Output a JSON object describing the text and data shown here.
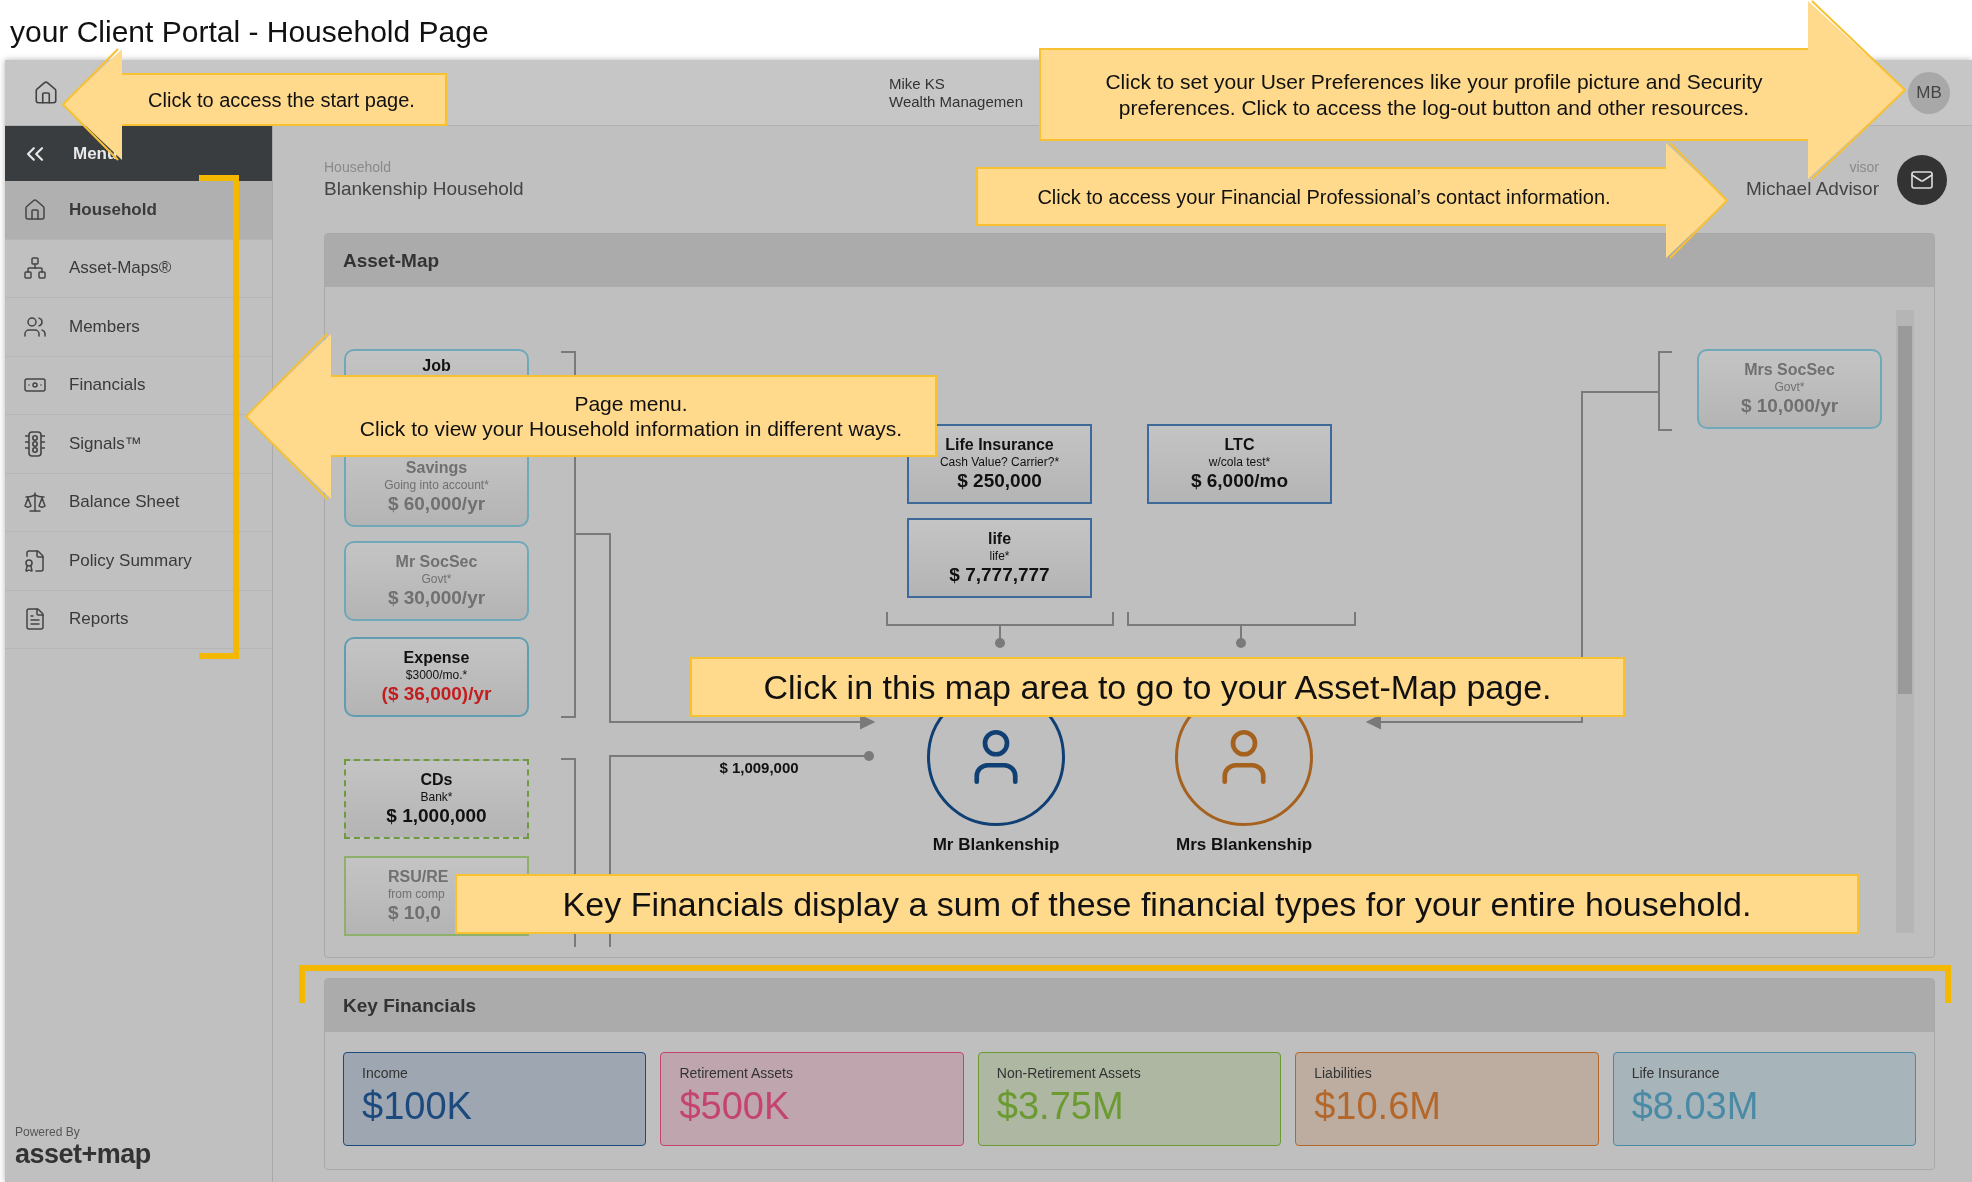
{
  "page_title": "your Client Portal - Household Page",
  "top_bar": {
    "firm_line_1": "Mike KS",
    "firm_line_2": "Wealth Managemen",
    "avatar": "MB"
  },
  "sidebar": {
    "menu_label": "Menu",
    "items": [
      {
        "label": "Household",
        "selected": true
      },
      {
        "label": "Asset-Maps®",
        "selected": false
      },
      {
        "label": "Members",
        "selected": false
      },
      {
        "label": "Financials",
        "selected": false
      },
      {
        "label": "Signals™",
        "selected": false
      },
      {
        "label": "Balance Sheet",
        "selected": false
      },
      {
        "label": "Policy Summary",
        "selected": false
      },
      {
        "label": "Reports",
        "selected": false
      }
    ],
    "powered_by": "Powered By",
    "logo": "asset+map"
  },
  "header": {
    "label": "Household",
    "name": "Blankenship Household",
    "advisor_label": "visor",
    "advisor_name": "Michael Advisor"
  },
  "asset_map": {
    "title": "Asset-Map",
    "nodes": [
      {
        "title": "Job",
        "kind": "income",
        "dimmed": false
      },
      {
        "title": "Savings",
        "subtitle": "Going into account*",
        "value": "$ 60,000/yr",
        "kind": "income",
        "dimmed": true
      },
      {
        "title": "Mr SocSec",
        "subtitle": "Govt*",
        "value": "$ 30,000/yr",
        "kind": "income",
        "dimmed": true
      },
      {
        "title": "Expense",
        "subtitle": "$3000/mo.*",
        "value": "($ 36,000)/yr",
        "kind": "expense",
        "dimmed": false
      },
      {
        "title": "CDs",
        "subtitle": "Bank*",
        "value": "$ 1,000,000",
        "kind": "account",
        "dimmed": false
      },
      {
        "title": "RSU/RE",
        "subtitle": "from comp",
        "value": "$ 10,0",
        "kind": "asset",
        "dimmed": true
      },
      {
        "title": "Life Insurance",
        "subtitle": "Cash Value? Carrier?*",
        "value": "$ 250,000",
        "kind": "insurance",
        "dimmed": false
      },
      {
        "title": "life",
        "subtitle": "life*",
        "value": "$ 7,777,777",
        "kind": "insurance",
        "dimmed": false
      },
      {
        "title": "LTC",
        "subtitle": "w/cola test*",
        "value": "$ 6,000/mo",
        "kind": "insurance",
        "dimmed": false
      },
      {
        "title": "Mrs SocSec",
        "subtitle": "Govt*",
        "value": "$ 10,000/yr",
        "kind": "income",
        "dimmed": true
      }
    ],
    "flow_label": "$ 1,009,000",
    "members": [
      {
        "name": "Mr Blankenship",
        "color": "#0f3f73"
      },
      {
        "name": "Mrs Blankenship",
        "color": "#a5621f"
      }
    ]
  },
  "key_financials": {
    "title": "Key Financials",
    "cards": [
      {
        "label": "Income",
        "value": "$100K",
        "color": "#1c4a7e"
      },
      {
        "label": "Retirement Assets",
        "value": "$500K",
        "color": "#c4436f"
      },
      {
        "label": "Non-Retirement Assets",
        "value": "$3.75M",
        "color": "#6a9a30"
      },
      {
        "label": "Liabilities",
        "value": "$10.6M",
        "color": "#b4672a"
      },
      {
        "label": "Life Insurance",
        "value": "$8.03M",
        "color": "#4a8aa5"
      }
    ]
  },
  "callouts": [
    {
      "text": "Click to access the start page."
    },
    {
      "text": "Click to set your User Preferences like your profile picture and Security preferences. Click to access the log-out button and other resources."
    },
    {
      "text": "Click to access your Financial Professional’s contact information."
    },
    {
      "text": "Page menu.\nClick to view your Household information in different ways."
    },
    {
      "text": "Click in this map area to go to your Asset-Map page."
    },
    {
      "text": "Key Financials display a sum of these financial types for your entire household."
    }
  ]
}
